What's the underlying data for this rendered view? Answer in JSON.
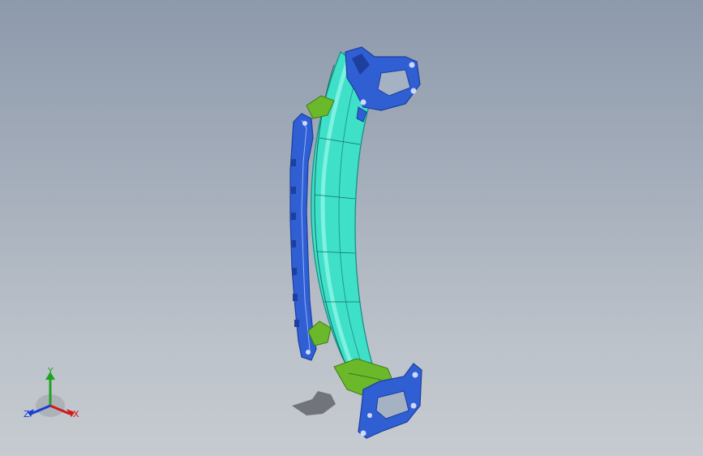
{
  "view": {
    "background_top": "#8d9aac",
    "background_bottom": "#c6cbd0",
    "model": {
      "name": "",
      "colors": {
        "bracket_blue": "#2f5fd3",
        "bracket_blue_dark": "#1d3f9e",
        "beam_cyan": "#3fe0c8",
        "beam_cyan_light": "#8ff5e6",
        "clip_green": "#6bb82a",
        "shadow": "#5a6068"
      }
    },
    "triad": {
      "x_label": "X",
      "y_label": "Y",
      "z_label": "Z",
      "x_color": "#d01a1a",
      "y_color": "#1fa31f",
      "z_color": "#1a3fd0"
    }
  }
}
